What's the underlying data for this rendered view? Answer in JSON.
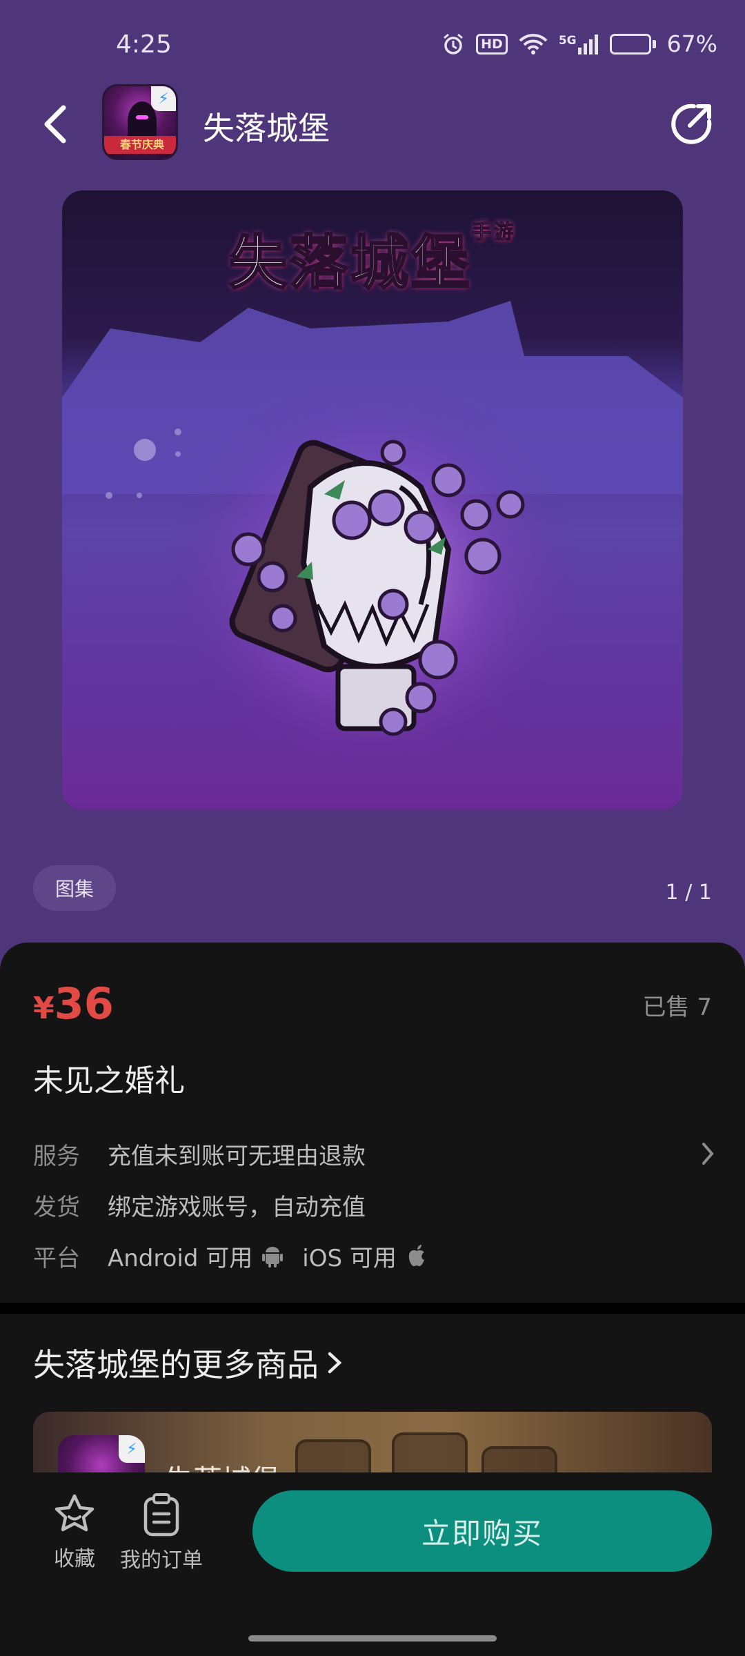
{
  "status_bar": {
    "time": "4:25",
    "hd": "HD",
    "network": "5G",
    "battery_level": 0.67,
    "battery_text": "67%",
    "icons": [
      "alarm-icon",
      "hd-icon",
      "wifi-icon",
      "signal-5g-icon",
      "battery-icon"
    ]
  },
  "header": {
    "title": "失落城堡",
    "app_icon_ribbon": "春节庆典",
    "icons": [
      "back-icon",
      "share-icon"
    ]
  },
  "banner": {
    "title": "失落城堡",
    "title_tag": "手游"
  },
  "gallery": {
    "chip_label": "图集",
    "page_indicator": "1 / 1"
  },
  "product": {
    "currency": "¥",
    "price": "36",
    "sold": "已售 7",
    "name": "未见之婚礼",
    "rows": [
      {
        "label": "服务",
        "value": "充值未到账可无理由退款",
        "has_chevron": true
      },
      {
        "label": "发货",
        "value": "绑定游戏账号，自动充值"
      },
      {
        "label": "平台",
        "android": "Android 可用",
        "ios": "iOS 可用"
      }
    ]
  },
  "more": {
    "title": "失落城堡的更多商品",
    "card_name": "失落城堡"
  },
  "bottom_bar": {
    "favorite_label": "收藏",
    "orders_label": "我的订单",
    "buy_label": "立即购买"
  },
  "colors": {
    "page_bg": "#4f3579",
    "price_red": "#e24a45",
    "buy_teal": "#0c8f7f",
    "panel_dark": "#141414"
  }
}
